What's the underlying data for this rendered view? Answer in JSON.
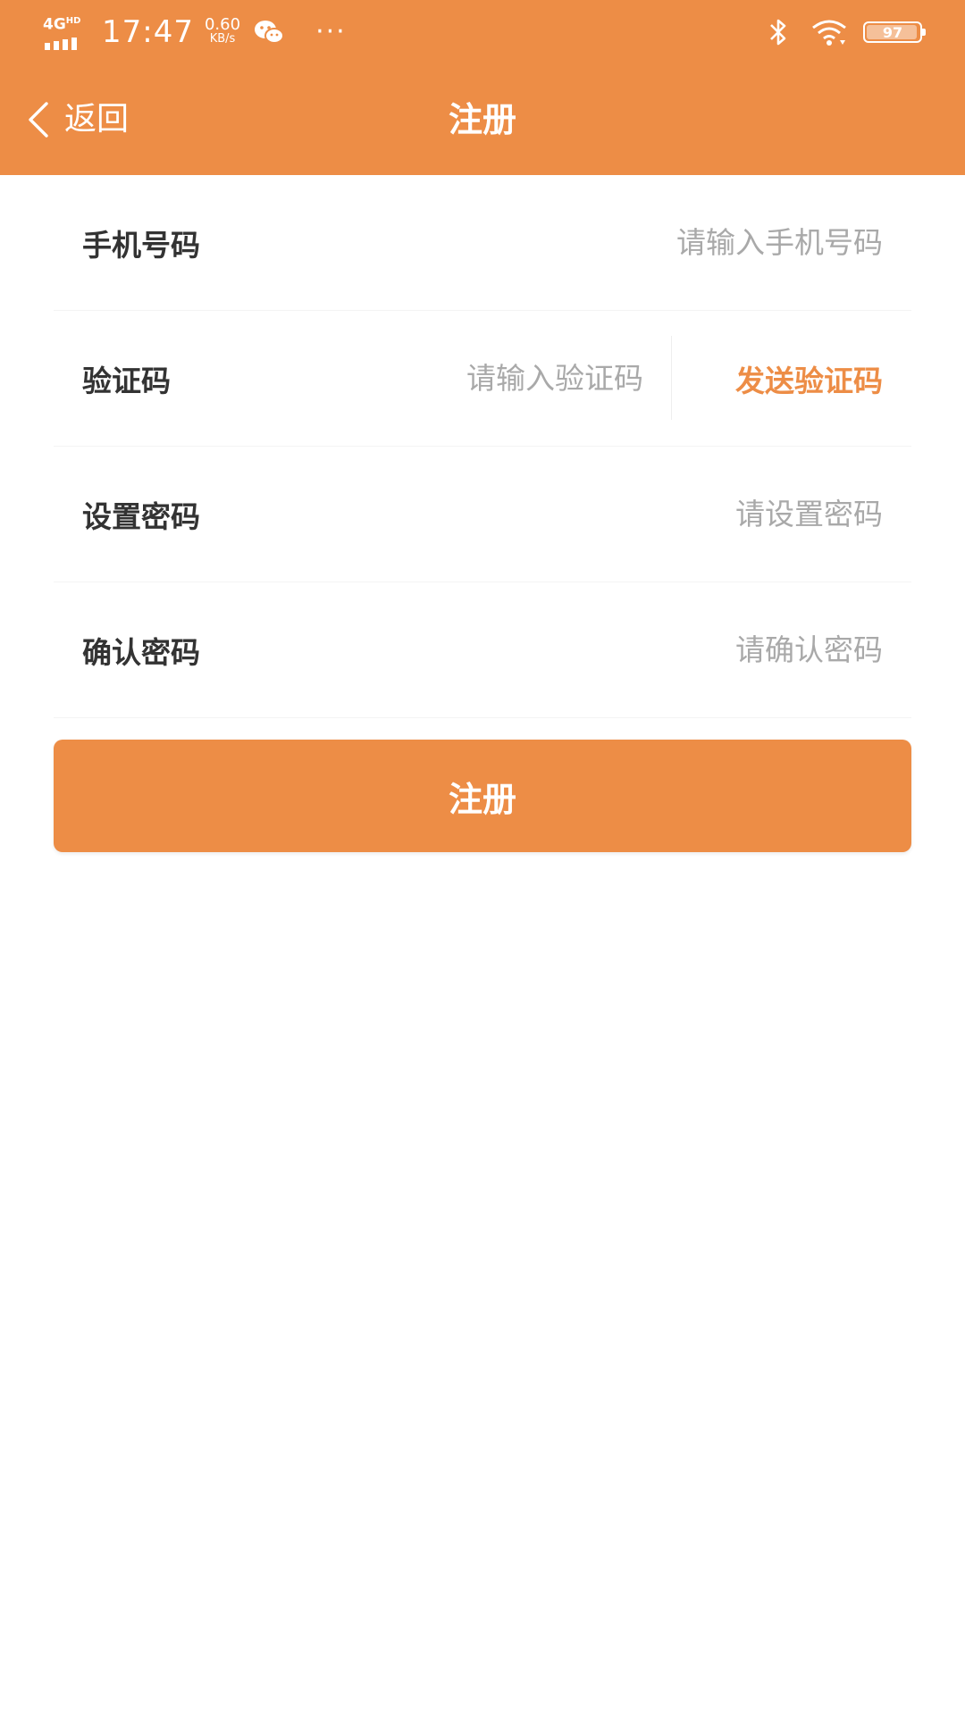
{
  "status_bar": {
    "network": "4G",
    "network_sub": "HD",
    "time": "17:47",
    "net_speed_value": "0.60",
    "net_speed_unit": "KB/s",
    "more": "···",
    "battery": "97",
    "battery_level": 0.97,
    "icons": [
      "signal-icon",
      "wechat-icon",
      "more-icon",
      "bluetooth-icon",
      "wifi-icon",
      "battery-icon"
    ]
  },
  "nav": {
    "back_label": "返回",
    "title": "注册"
  },
  "form": {
    "phone": {
      "label": "手机号码",
      "placeholder": "请输入手机号码",
      "value": ""
    },
    "code": {
      "label": "验证码",
      "placeholder": "请输入验证码",
      "value": "",
      "send_label": "发送验证码"
    },
    "password": {
      "label": "设置密码",
      "placeholder": "请设置密码",
      "value": ""
    },
    "confirm": {
      "label": "确认密码",
      "placeholder": "请确认密码",
      "value": ""
    }
  },
  "submit_label": "注册",
  "colors": {
    "accent": "#ED8D46",
    "text": "#333333",
    "placeholder": "#A9A9A9",
    "background": "#FFFFFF"
  }
}
